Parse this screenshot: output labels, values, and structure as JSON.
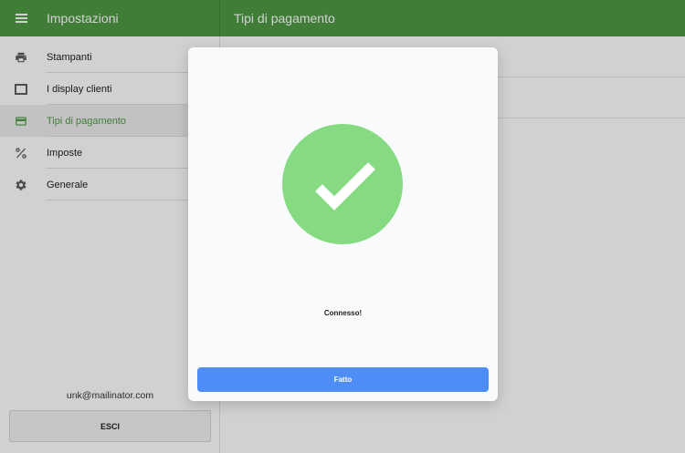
{
  "appbar": {
    "menu_icon": "hamburger-menu-icon",
    "title": "Impostazioni",
    "page_title": "Tipi di pagamento",
    "color": "#4f9a45"
  },
  "sidebar": {
    "items": [
      {
        "label": "Stampanti",
        "icon": "printer-icon",
        "active": false
      },
      {
        "label": "I display clienti",
        "icon": "display-icon",
        "active": false
      },
      {
        "label": "Tipi di pagamento",
        "icon": "credit-card-icon",
        "active": true
      },
      {
        "label": "Imposte",
        "icon": "percent-icon",
        "active": false
      },
      {
        "label": "Generale",
        "icon": "gear-icon",
        "active": false
      }
    ],
    "user_email": "unk@mailinator.com",
    "logout_label": "ESCI"
  },
  "dialog": {
    "icon": "checkmark-circle-icon",
    "message": "Connesso!",
    "done_label": "Fatto",
    "success_color": "#86db82",
    "button_color": "#4d8df5"
  }
}
